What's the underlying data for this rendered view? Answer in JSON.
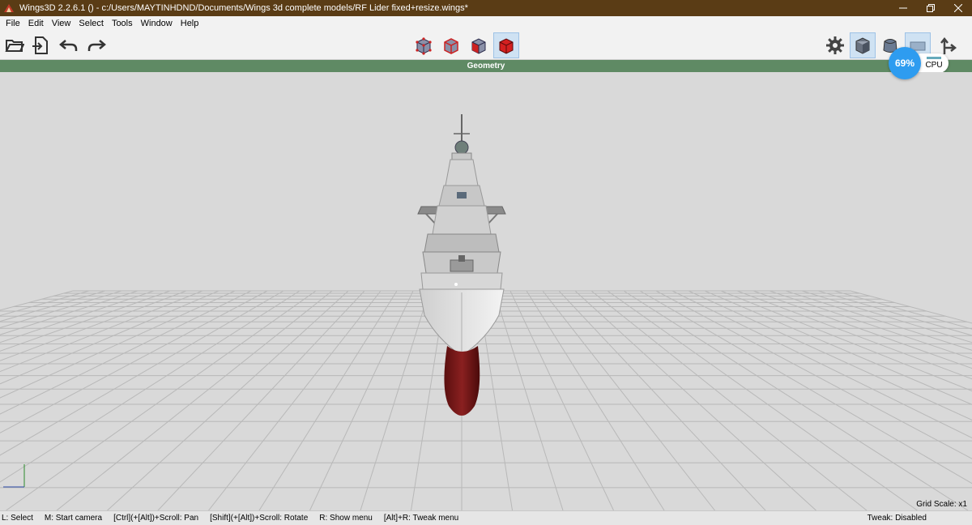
{
  "window": {
    "title": "Wings3D 2.2.6.1 () - c:/Users/MAYTINHDND/Documents/Wings 3d complete models/RF Lider fixed+resize.wings*",
    "controls": [
      "minimize-icon",
      "restore-icon",
      "close-icon"
    ]
  },
  "menu": {
    "items": [
      "File",
      "Edit",
      "View",
      "Select",
      "Tools",
      "Window",
      "Help"
    ]
  },
  "toolbar": {
    "left_icons": [
      "open-folder-icon",
      "import-icon",
      "undo-icon",
      "redo-icon"
    ],
    "select_modes": [
      "vertex-mode-icon",
      "edge-mode-icon",
      "face-mode-icon",
      "body-mode-icon"
    ],
    "active_mode": "body-mode-icon",
    "right_icons": [
      "gear-icon",
      "shaded-cube-icon",
      "smooth-cube-icon",
      "workmode-icon",
      "axis-toggle-icon"
    ]
  },
  "geometry": {
    "label": "Geometry"
  },
  "cpu": {
    "percent": "69%",
    "label": "CPU"
  },
  "viewport": {
    "grid_scale": "Grid Scale: x1",
    "colors": {
      "background": "#d9d9d9",
      "grid": "#b8b8b8",
      "hull": "#e6e6e6",
      "bulb": "#7e1a1a"
    }
  },
  "status": {
    "hints": [
      "L: Select",
      "M: Start camera",
      "[Ctrl](+[Alt])+Scroll: Pan",
      "[Shift](+[Alt])+Scroll: Rotate",
      "R: Show menu",
      "[Alt]+R: Tweak menu"
    ],
    "tweak": "Tweak: Disabled"
  },
  "colors": {
    "titlebar": "#5a3c15",
    "geometry_bar": "#5f8a64",
    "cpu_accent": "#2e9cf0"
  }
}
